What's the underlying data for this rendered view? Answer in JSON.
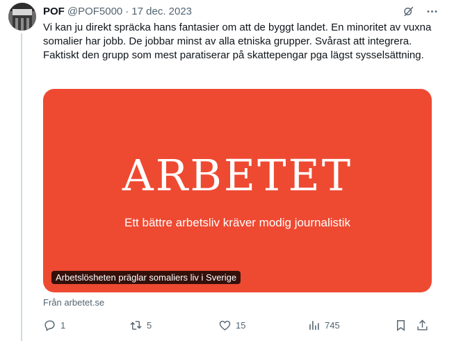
{
  "tweet": {
    "author_name": "POF",
    "author_handle": "@POF5000",
    "separator": "·",
    "date": "17 dec. 2023",
    "text": "Vi kan ju direkt spräcka hans fantasier om att de byggt landet. En minoritet av vuxna somalier har jobb. De jobbar minst av alla etniska grupper. Svårast att integrera. Faktiskt den grupp som mest paratiserar på skattepengar pga lägst sysselsättning."
  },
  "card": {
    "logo_text": "ARBETET",
    "tagline": "Ett bättre arbetsliv kräver modig journalistik",
    "caption": "Arbetslösheten präglar somaliers liv i Sverige",
    "background_color": "#ee4a32",
    "source": "Från arbetet.se"
  },
  "actions": {
    "replies": "1",
    "retweets": "5",
    "likes": "15",
    "views": "745"
  },
  "icons": {
    "grok": "grok-icon",
    "more": "more-icon",
    "reply": "reply-icon",
    "retweet": "retweet-icon",
    "like": "heart-icon",
    "views": "views-icon",
    "bookmark": "bookmark-icon",
    "share": "share-icon"
  }
}
